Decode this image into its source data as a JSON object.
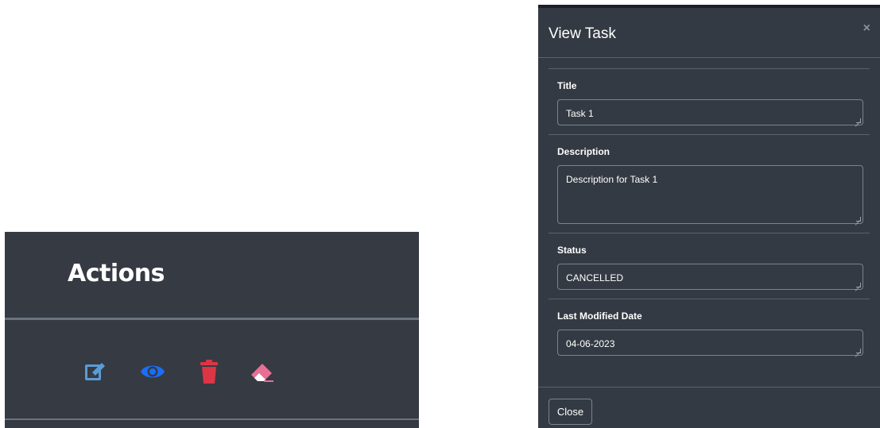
{
  "actions_panel": {
    "title": "Actions",
    "icons": [
      {
        "name": "edit-icon",
        "color": "#5b9bd5"
      },
      {
        "name": "eye-icon",
        "color": "#1a6ef5"
      },
      {
        "name": "trash-icon",
        "color": "#dc3545"
      },
      {
        "name": "eraser-icon",
        "color": "#e76f93"
      }
    ]
  },
  "modal": {
    "title": "View Task",
    "close_glyph": "×",
    "fields": {
      "title": {
        "label": "Title",
        "value": "Task 1"
      },
      "description": {
        "label": "Description",
        "value": "Description for Task 1"
      },
      "status": {
        "label": "Status",
        "value": "CANCELLED"
      },
      "last_modified": {
        "label": "Last Modified Date",
        "value": "04-06-2023"
      }
    },
    "close_button_label": "Close"
  },
  "colors": {
    "panel_bg": "#353a43",
    "divider": "#6b7480",
    "text": "#ffffff"
  }
}
